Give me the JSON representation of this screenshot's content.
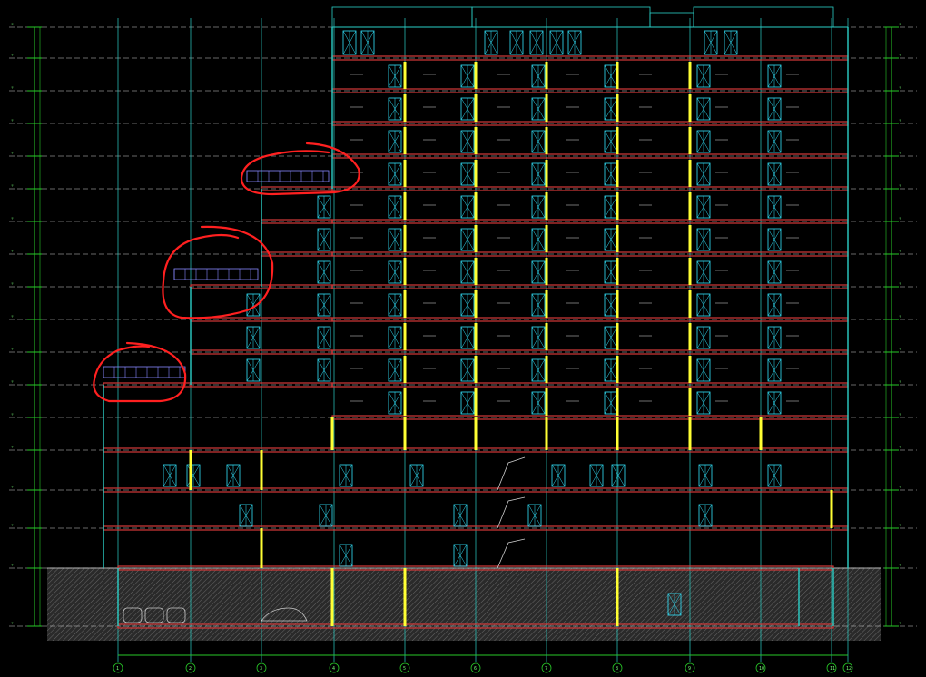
{
  "drawing": {
    "type": "architectural-section-elevation",
    "colors": {
      "background": "#000000",
      "floor_slab": "#d43a3a",
      "grid_line": "#2bd0c8",
      "dimension": "#28c828",
      "window": "#33e6ff",
      "column": "#ffff33",
      "markup_circle": "#ff2020",
      "ground_hatch": "#777777"
    },
    "axis_labels": [
      "1",
      "2",
      "3",
      "4",
      "5",
      "6",
      "7",
      "8",
      "9",
      "10",
      "11",
      "12"
    ],
    "markup_circles": 3
  }
}
